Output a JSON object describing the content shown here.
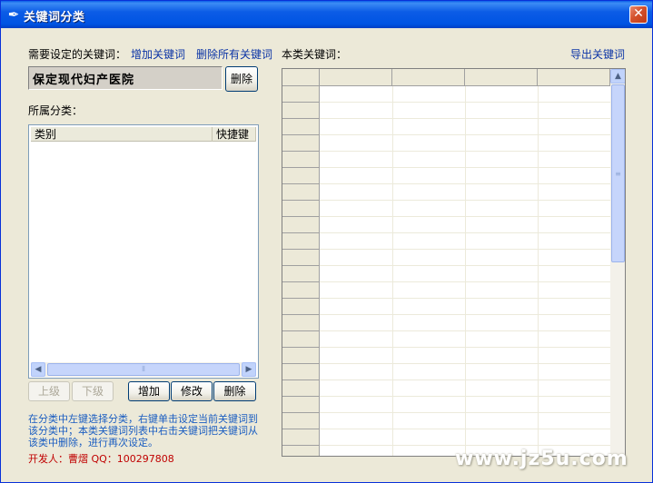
{
  "window": {
    "title": "关键词分类",
    "icon": "pen-nib-icon",
    "close_label": "✕"
  },
  "keyword_section": {
    "label": "需要设定的关键词：",
    "add_link": "增加关键词",
    "delete_all_link": "删除所有关键词",
    "current_keyword": "保定现代妇产医院",
    "delete_button": "删除"
  },
  "category_section": {
    "label": "所属分类：",
    "columns": [
      "类别",
      "快捷键"
    ],
    "rows": []
  },
  "category_buttons": {
    "up": "上级",
    "down": "下级",
    "add": "增加",
    "edit": "修改",
    "delete": "删除"
  },
  "hint_text": "在分类中左键选择分类，右键单击设定当前关键词到该分类中；本类关键词列表中右击关键词把关键词从该类中删除，进行再次设定。",
  "developer": "开发人：曹熠 QQ：100297808",
  "keywords_panel": {
    "label": "本类关键词：",
    "export_link": "导出关键词",
    "columns": [
      "",
      "",
      "",
      ""
    ],
    "rows": []
  },
  "watermark": "www.jz5u.com",
  "colors": {
    "titlebar": "#0054e3",
    "link": "#0b34a6",
    "hint": "#1a5dc1",
    "developer": "#c00000",
    "dialog_bg": "#ece9d8"
  }
}
